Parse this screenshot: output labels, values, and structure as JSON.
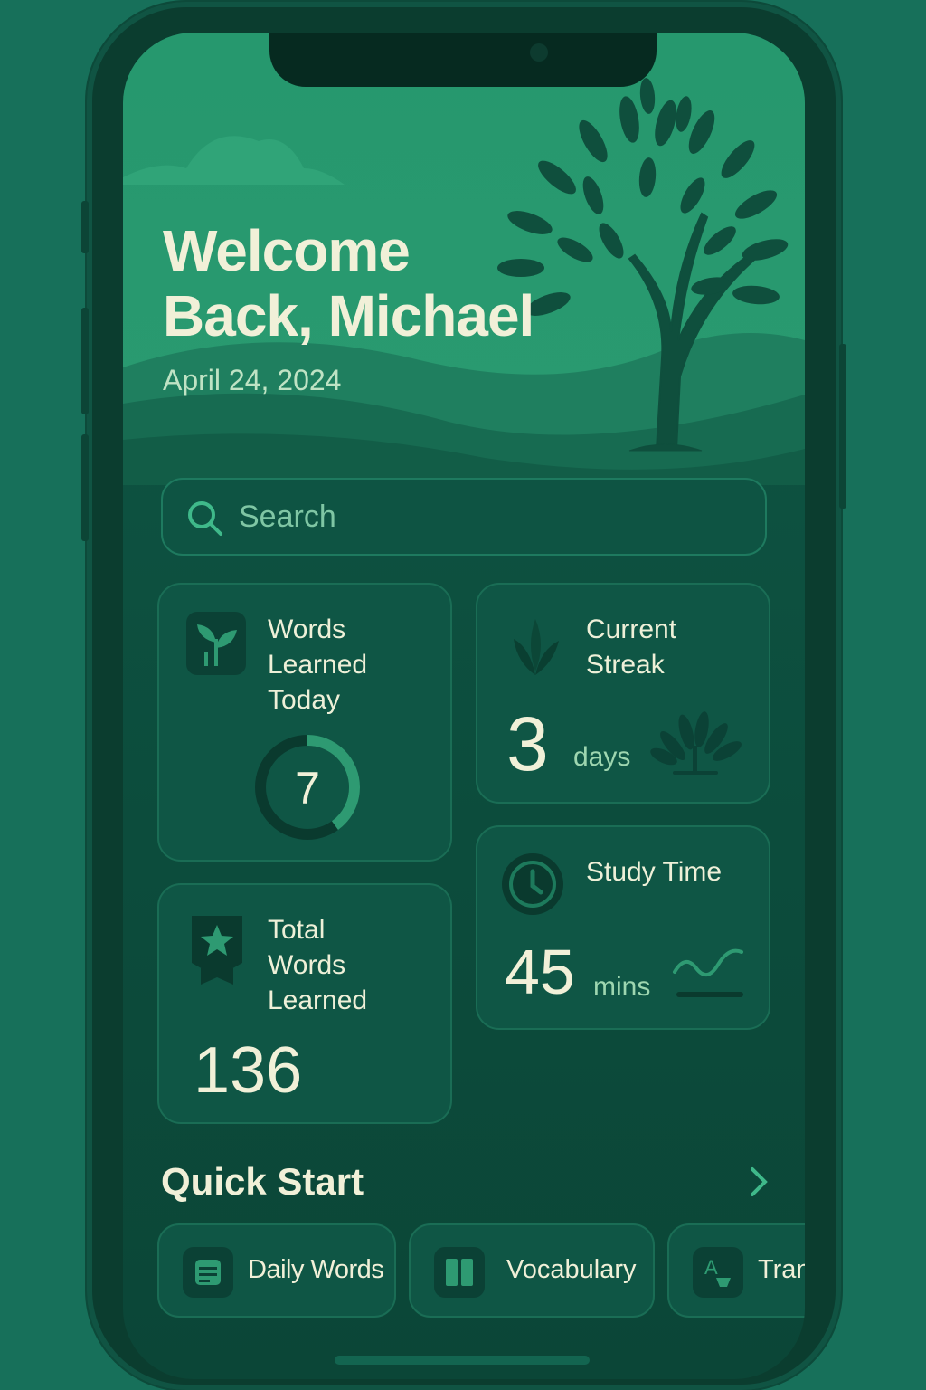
{
  "header": {
    "welcome_line1": "Welcome",
    "welcome_line2": "Back, Michael",
    "date": "April 24, 2024"
  },
  "search": {
    "placeholder": "Search"
  },
  "stats": {
    "words_today": {
      "title_lines": [
        "Words",
        "Learned",
        "Today"
      ],
      "value": "7",
      "progress_fraction": 0.4,
      "icon": "sprout-icon"
    },
    "streak": {
      "title_lines": [
        "Current",
        "Streak"
      ],
      "value": "3",
      "unit": "days",
      "icon": "leaves-icon"
    },
    "total_words": {
      "title_lines": [
        "Total",
        "Words",
        "Learned"
      ],
      "value": "136",
      "icon": "star-badge-icon"
    },
    "study_time": {
      "title": "Study Time",
      "value": "45",
      "unit": "mins",
      "icon": "clock-icon"
    }
  },
  "quick_start": {
    "title": "Quick Start",
    "items": [
      {
        "label": "Daily Words",
        "icon": "list-icon"
      },
      {
        "label": "Vocabulary",
        "icon": "book-icon"
      },
      {
        "label": "Tran",
        "icon": "translate-icon"
      }
    ]
  },
  "colors": {
    "accent": "#2e9a72",
    "text": "#f1f0d8",
    "card": "#0f5645"
  }
}
